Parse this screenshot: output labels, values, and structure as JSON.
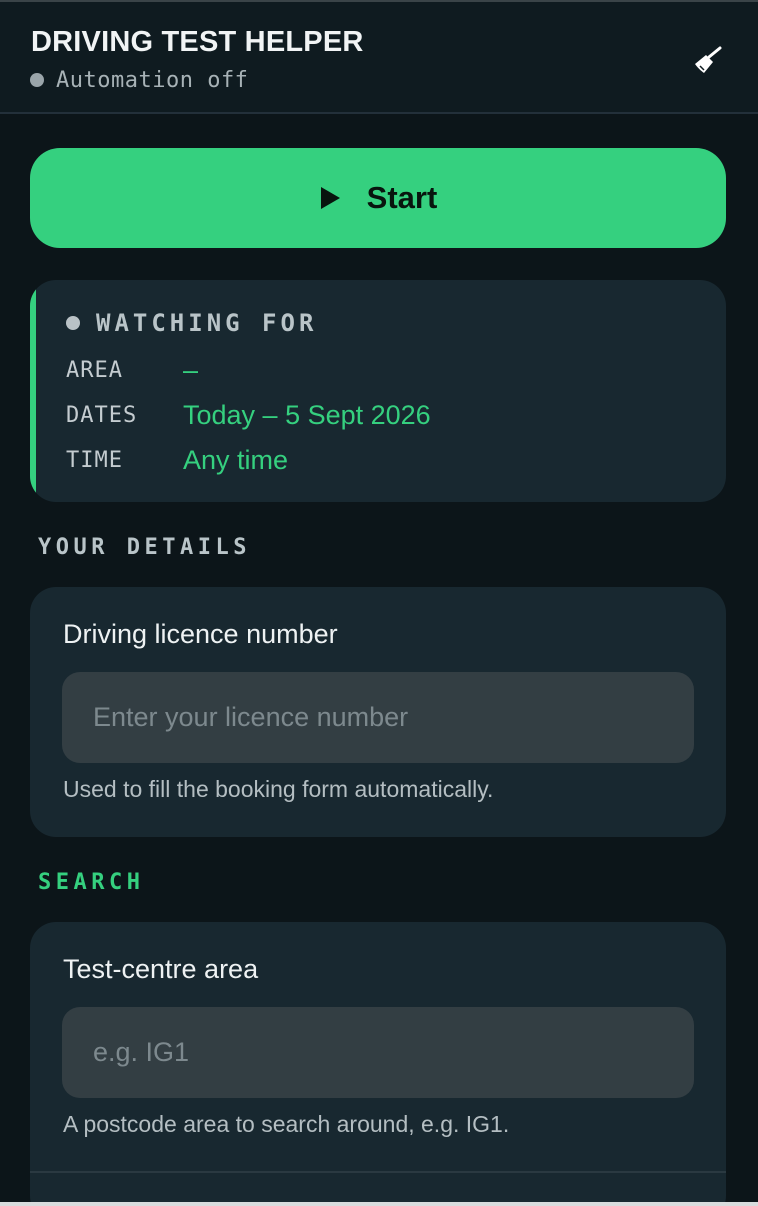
{
  "header": {
    "title": "DRIVING TEST HELPER",
    "status": "Automation off",
    "clean_icon": "broom-icon"
  },
  "start_button": {
    "label": "Start",
    "icon": "play-icon",
    "color": "#35d07f"
  },
  "watching": {
    "title": "WATCHING FOR",
    "rows": [
      {
        "key": "AREA",
        "value": "–"
      },
      {
        "key": "DATES",
        "value": "Today – 5 Sept 2026"
      },
      {
        "key": "TIME",
        "value": "Any time"
      }
    ]
  },
  "your_details": {
    "section_label": "YOUR DETAILS",
    "licence": {
      "label": "Driving licence number",
      "placeholder": "Enter your licence number",
      "value": "",
      "help": "Used to fill the booking form automatically."
    }
  },
  "search": {
    "section_label": "SEARCH",
    "area": {
      "label": "Test-centre area",
      "placeholder": "e.g. IG1",
      "value": "",
      "help": "A postcode area to search around, e.g. IG1."
    }
  },
  "colors": {
    "background": "#0c1519",
    "card": "#182830",
    "accent": "#35d07f",
    "input": "#333e43"
  }
}
